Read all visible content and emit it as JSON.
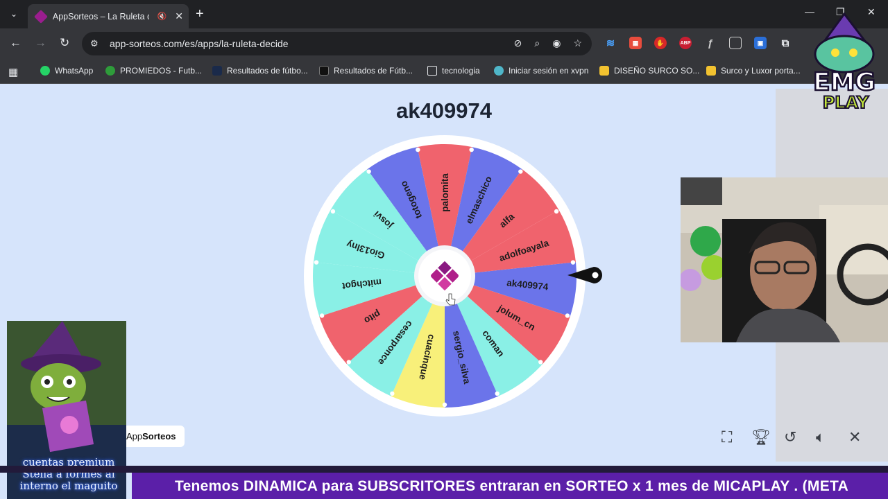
{
  "browser": {
    "tab_title": "AppSorteos – La Ruleta de I",
    "url": "app-sorteos.com/es/apps/la-ruleta-decide",
    "bookmarks": [
      {
        "label": "WhatsApp",
        "color": "#25d366"
      },
      {
        "label": "PROMIEDOS - Futb...",
        "color": "#2e9c3a"
      },
      {
        "label": "Resultados de fútbo...",
        "color": "#1a2a4a"
      },
      {
        "label": "Resultados de Fútb...",
        "color": "#111111"
      },
      {
        "label": "tecnologia",
        "color": "#e8eaed"
      },
      {
        "label": "Iniciar sesión en xvpn",
        "color": "#4fb6c9"
      },
      {
        "label": "DISEÑO SURCO SO...",
        "color": "#f2c230"
      },
      {
        "label": "Surco y Luxor porta...",
        "color": "#f2c230"
      }
    ]
  },
  "page": {
    "winner_title": "ak409974",
    "badge_app": "App",
    "badge_name": "Sorteos"
  },
  "wheel": {
    "segments": [
      {
        "label": "ak409974",
        "color": "#6b74ea"
      },
      {
        "label": "jolum_cn",
        "color": "#f0636d"
      },
      {
        "label": "coman",
        "color": "#8af0e6"
      },
      {
        "label": "sergio_silva",
        "color": "#6b74ea"
      },
      {
        "label": "cuacinque",
        "color": "#f8f07a"
      },
      {
        "label": "cesarponce",
        "color": "#8af0e6"
      },
      {
        "label": "pito",
        "color": "#f0636d"
      },
      {
        "label": "mitchgot",
        "color": "#8af0e6"
      },
      {
        "label": "Gio13lny",
        "color": "#8af0e6"
      },
      {
        "label": "josvi",
        "color": "#8af0e6"
      },
      {
        "label": "totogeno",
        "color": "#6b74ea"
      },
      {
        "label": "palomita",
        "color": "#f0636d"
      },
      {
        "label": "elmaschico",
        "color": "#6b74ea"
      },
      {
        "label": "alfa",
        "color": "#f0636d"
      },
      {
        "label": "adolfoayala",
        "color": "#f0636d"
      }
    ]
  },
  "overlay": {
    "promo_text": "cuentas premium Stella a formes al interno el maguito",
    "logo_line1": "EMG",
    "logo_line2": "PLAY",
    "ticker": "Tenemos DINAMICA para SUBSCRITORES entraran en SORTEO x 1 mes de MICAPLAY .  (META"
  }
}
